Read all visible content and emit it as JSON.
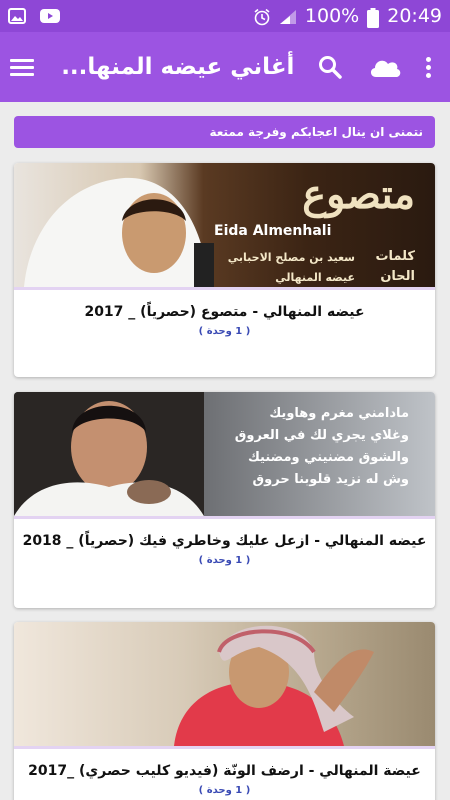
{
  "status_bar": {
    "battery": "100%",
    "time": "20:49"
  },
  "toolbar": {
    "title": "أغاني عيضه المنها..."
  },
  "banner": {
    "text": "نتمنى ان ينال اعجابكم وفرجة ممتعة"
  },
  "cards": [
    {
      "title": "عيضه المنهالي - متصوع (حصرياً) _ 2017",
      "count": "( 1 وحدة )",
      "thumb": {
        "logo_text": "متصوع",
        "english_name": "Eida Almenhali",
        "lyrics_label": "كلمات",
        "lyrics_value": "سعيد بن مصلح الاحبابي",
        "music_label": "الحان",
        "music_value": "عيضه المنهالي"
      }
    },
    {
      "title": "عيضه المنهالي - ازعل عليك وخاطري فيك (حصرياً) _ 2018",
      "count": "( 1 وحدة )",
      "thumb": {
        "lines": [
          "مادامني مغرم وهاويك",
          "وغلاي يجري لك في العروق",
          "والشوق مضنيني ومضنيك",
          "وش له نزيد قلوبنا حروق"
        ]
      }
    },
    {
      "title": "عيضة المنهالي - ارضف الونّة (فيديو كليب حصري) _2017",
      "count": "( 1 وحدة )",
      "thumb": {}
    }
  ]
}
